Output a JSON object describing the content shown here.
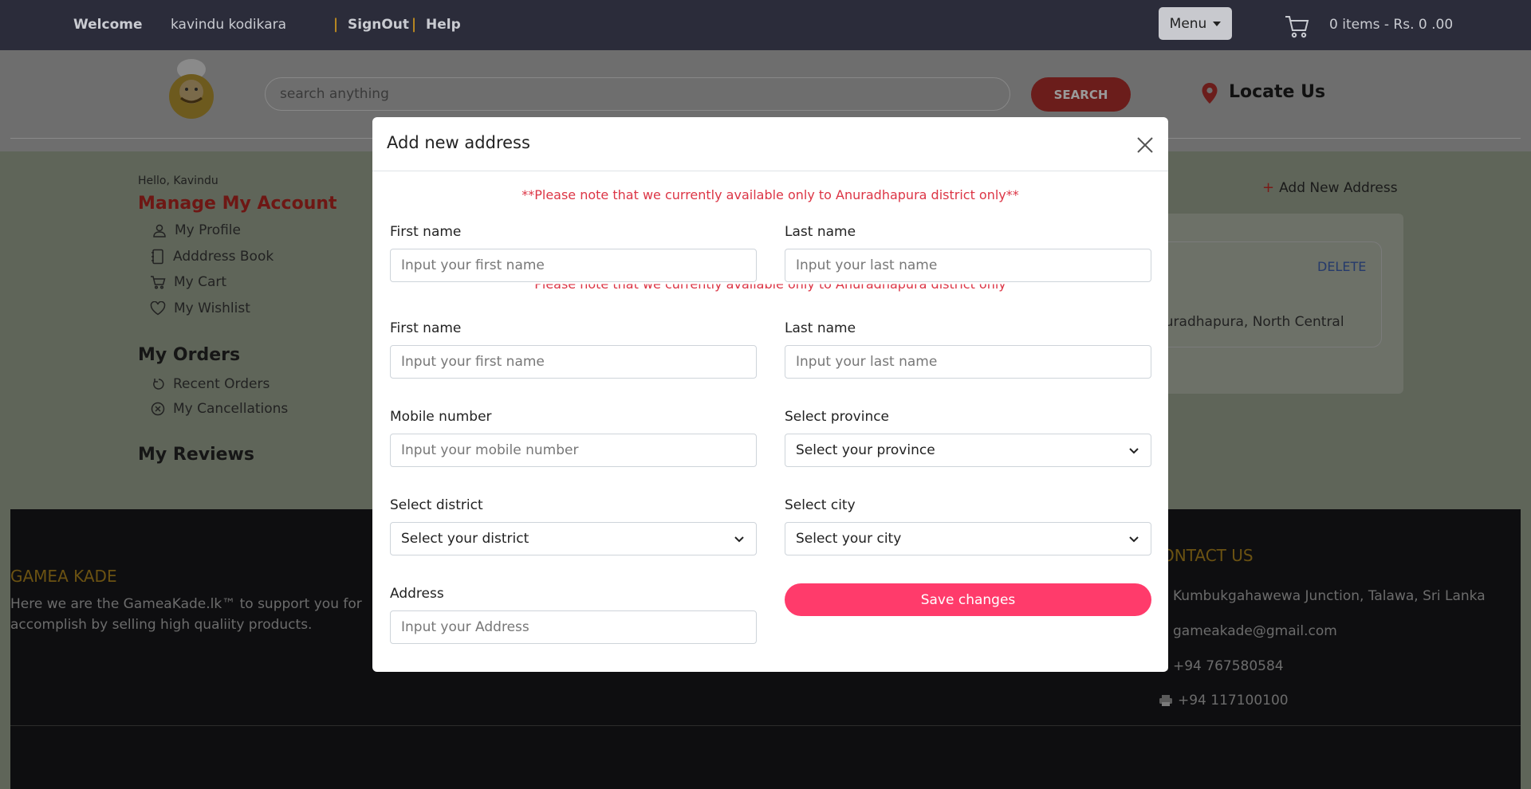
{
  "topbar": {
    "welcome": "Welcome",
    "username": "kavindu kodikara",
    "signout": "SignOut",
    "help": "Help",
    "menu": "Menu",
    "cart_summary": "0 items - Rs. 0 .00"
  },
  "header": {
    "search_placeholder": "search anything",
    "search_button": "SEARCH",
    "locate": "Locate Us"
  },
  "account": {
    "hello": "Hello, Kavindu",
    "manage_title": "Manage My Account",
    "manage_items": [
      "My  Profile",
      "Adddress   Book",
      "My  Cart",
      "My  Wishlist"
    ],
    "orders_title": "My Orders",
    "order_items": [
      "Recent Orders",
      "My Cancellations"
    ],
    "reviews_title": "My Reviews",
    "add_new_address": "Add New Address",
    "delete": "DELETE",
    "address_fragment": "nuradhapura, North Central"
  },
  "footer": {
    "brand": "GAMEA KADE",
    "tagline": "Here we are the GameaKade.lk™ to support you for accomplish by selling high qualiity products.",
    "contact_title": "ONTACT US",
    "address": "Kumbukgahawewa Junction, Talawa, Sri Lanka",
    "email": "gameakade@gmail.com",
    "phone": "+94 767580584",
    "fax": "+94 117100100"
  },
  "modal": {
    "title": "Add new address",
    "notice": "**Please note that we currently available only to Anuradhapura district only**",
    "notice_ghost": "Please note that we currently available only to Anuradhapura district only",
    "first_name_label": "First name",
    "first_name_placeholder": "Input your first name",
    "last_name_label": "Last name",
    "last_name_placeholder": "Input your last name",
    "mobile_label": "Mobile number",
    "mobile_placeholder": "Input your mobile number",
    "province_label": "Select province",
    "province_value": "Select your province",
    "district_label": "Select district",
    "district_value": "Select your district",
    "city_label": "Select city",
    "city_value": "Select your city",
    "address_label": "Address",
    "address_placeholder": "Input your Address",
    "save": "Save changes"
  },
  "colors": {
    "topbar": "#2b2c3a",
    "accent_red": "#dc3545",
    "save_button": "#ff3b6b",
    "footer_gold": "#e0a31c"
  }
}
